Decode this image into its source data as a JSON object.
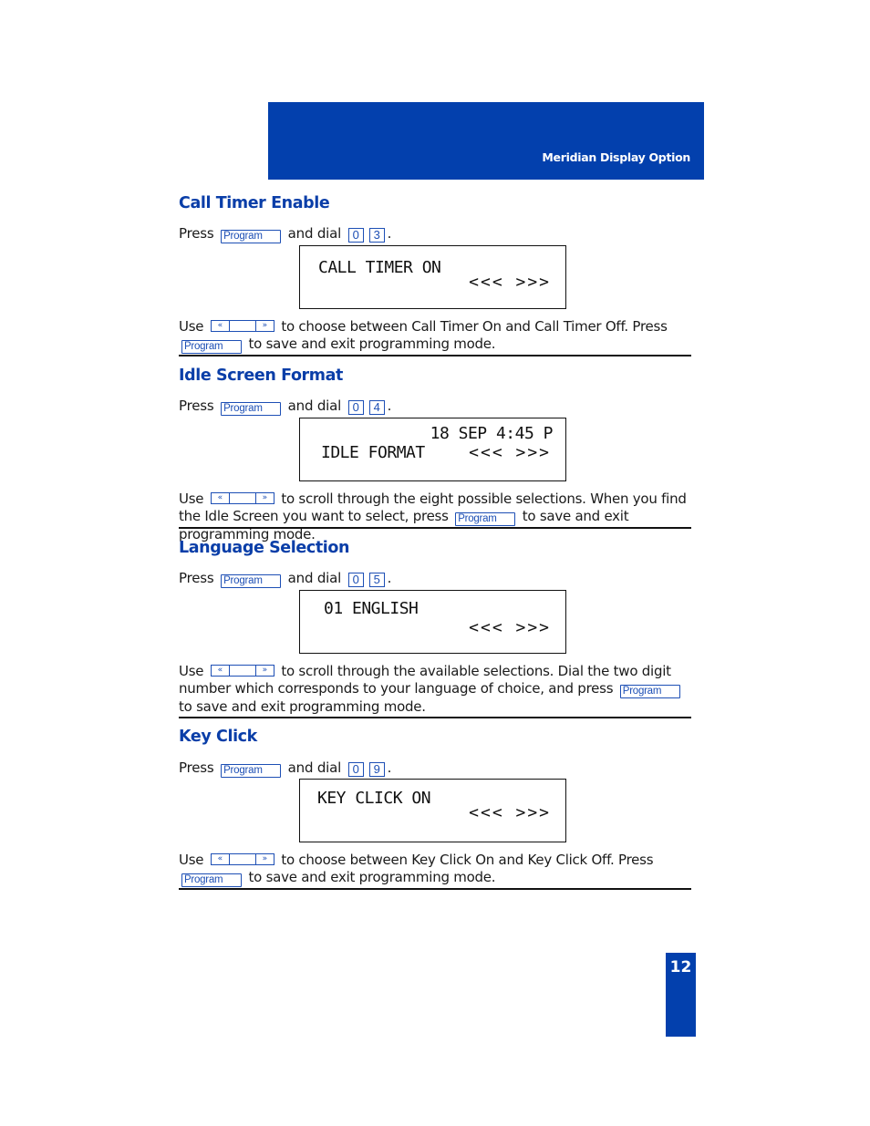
{
  "header": {
    "title": "Meridian Display Option"
  },
  "page_number": "12",
  "common": {
    "press": "Press",
    "and_dial": "and dial",
    "period": ".",
    "use": "Use",
    "program_label": "Program",
    "nav_left_glyph": "«",
    "nav_right_glyph": "»",
    "lcd_arrows": "<<< >>>"
  },
  "sections": [
    {
      "title": "Call Timer Enable",
      "dial": [
        "0",
        "3"
      ],
      "lcd": {
        "line1": "CALL TIMER ON",
        "line2": ""
      },
      "desc_before": "to choose between Call Timer On and Call Timer Off. Press",
      "desc_after": "to save and exit programming mode."
    },
    {
      "title": "Idle Screen Format",
      "dial": [
        "0",
        "4"
      ],
      "lcd": {
        "line1": "18 SEP 4:45 P",
        "line2": "IDLE FORMAT"
      },
      "desc_before": "to scroll through the eight possible selections. When you find the Idle Screen you want to select, press",
      "desc_after": "to save and exit programming mode."
    },
    {
      "title": "Language Selection",
      "dial": [
        "0",
        "5"
      ],
      "lcd": {
        "line1": "01 ENGLISH",
        "line2": ""
      },
      "desc_before": "to scroll through the available selections. Dial the two digit number which corresponds to your language of choice, and press",
      "desc_after": "to save and exit programming mode."
    },
    {
      "title": "Key Click",
      "dial": [
        "0",
        "9"
      ],
      "lcd": {
        "line1": "KEY CLICK ON",
        "line2": ""
      },
      "desc_before": "to choose between Key Click On and Key Click Off. Press",
      "desc_after": "to save and exit programming mode."
    }
  ]
}
